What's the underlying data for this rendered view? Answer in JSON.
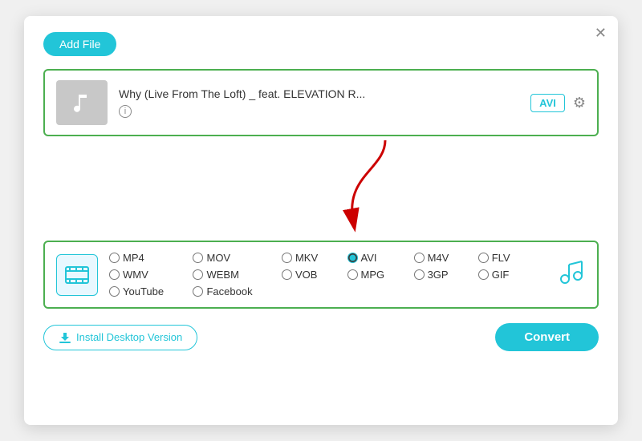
{
  "dialog": {
    "close_label": "✕",
    "add_file_label": "Add File",
    "file": {
      "title": "Why (Live From The Loft) _ feat. ELEVATION R...",
      "format_badge": "AVI"
    },
    "format_section": {
      "options_row1": [
        "MP4",
        "MOV",
        "MKV",
        "AVI",
        "M4V",
        "FLV",
        "WMV"
      ],
      "options_row2": [
        "WEBM",
        "VOB",
        "MPG",
        "3GP",
        "GIF",
        "YouTube",
        "Facebook"
      ],
      "selected": "AVI"
    },
    "install_btn_label": "Install Desktop Version",
    "convert_btn_label": "Convert"
  }
}
